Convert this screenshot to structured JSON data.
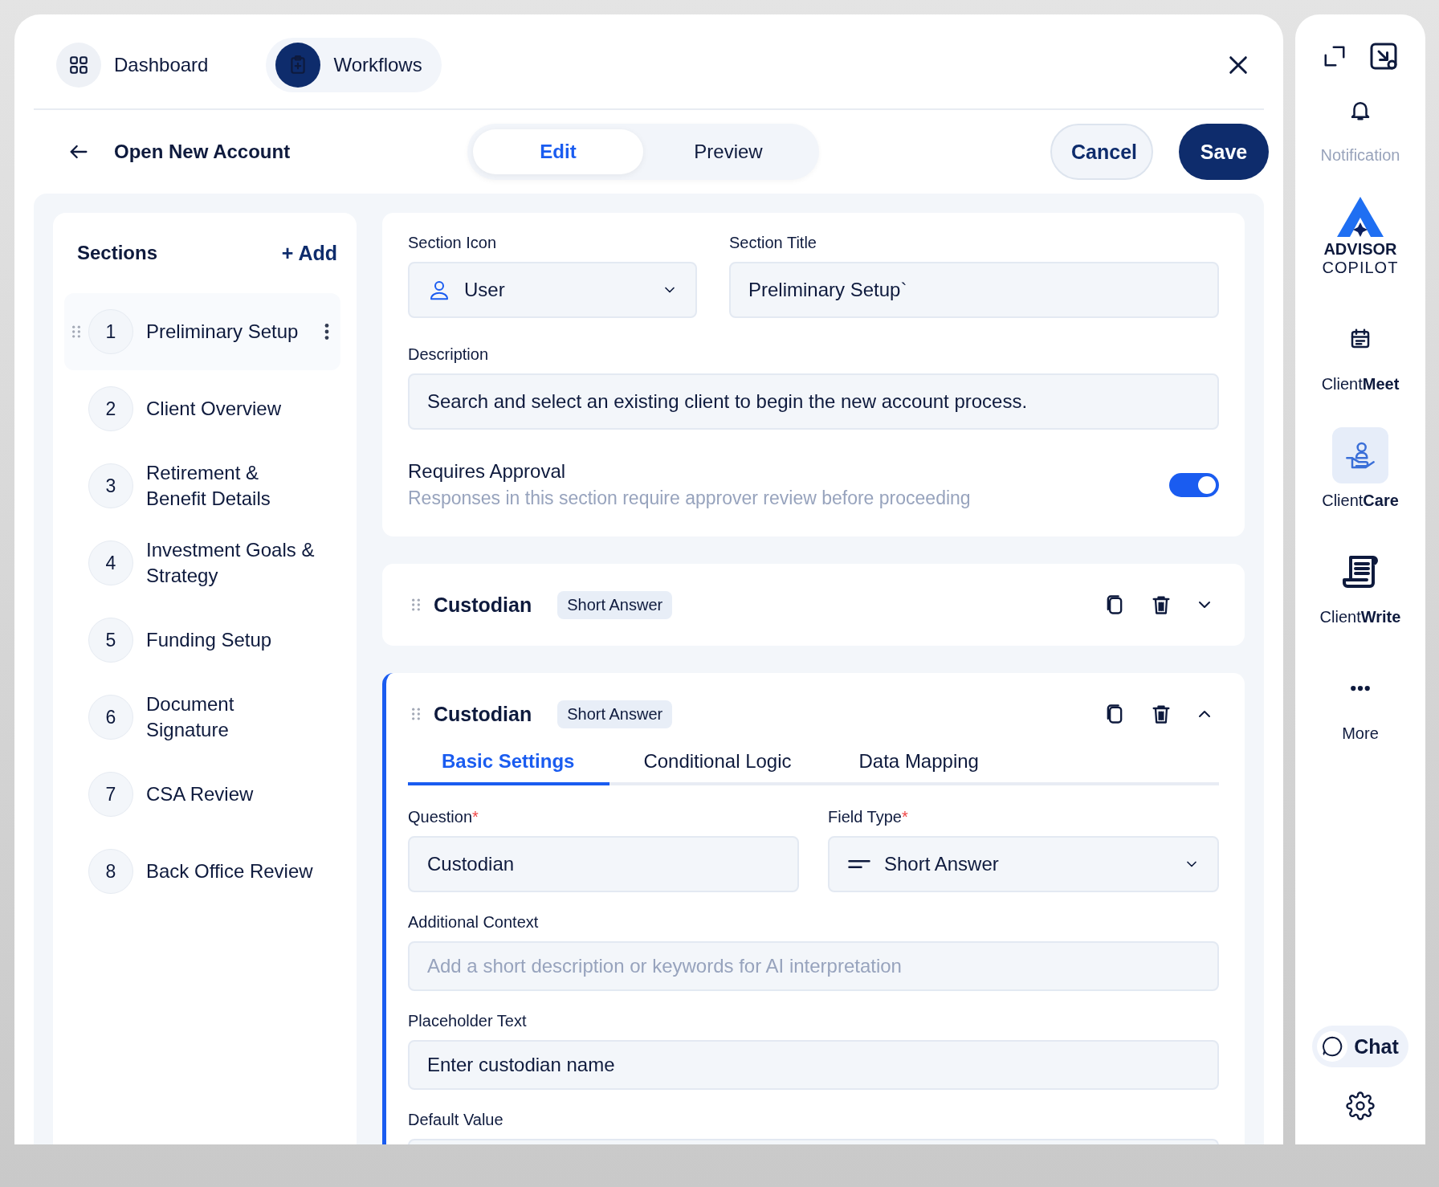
{
  "nav_tabs": [
    {
      "label": "Dashboard",
      "selected": false
    },
    {
      "label": "Workflows",
      "selected": true
    }
  ],
  "header": {
    "title": "Open New Account",
    "mode_tabs": [
      {
        "label": "Edit",
        "selected": true
      },
      {
        "label": "Preview",
        "selected": false
      }
    ],
    "buttons": [
      {
        "label": "Cancel",
        "kind": "secondary"
      },
      {
        "label": "Save",
        "kind": "primary"
      }
    ]
  },
  "sections": {
    "title": "Sections",
    "add_label": "+ Add",
    "items": [
      {
        "number": "1",
        "title": "Preliminary Setup",
        "selected": true
      },
      {
        "number": "2",
        "title": "Client Overview",
        "selected": false
      },
      {
        "number": "3",
        "title": "Retirement & Benefit Details",
        "selected": false
      },
      {
        "number": "4",
        "title": "Investment Goals & Strategy",
        "selected": false
      },
      {
        "number": "5",
        "title": "Funding Setup",
        "selected": false
      },
      {
        "number": "6",
        "title": "Document Signature",
        "selected": false
      },
      {
        "number": "7",
        "title": "CSA Review",
        "selected": false
      },
      {
        "number": "8",
        "title": "Back Office Review",
        "selected": false
      }
    ]
  },
  "section_settings": {
    "icon_label": "Section Icon",
    "icon_value": "User",
    "title_label": "Section Title",
    "title_value": "Preliminary Setup`",
    "description_label": "Description",
    "description_value": "Search and select an existing client to begin the new account process.",
    "approval": {
      "title": "Requires Approval",
      "hint": "Responses in this section require approver review before proceeding",
      "on": true
    }
  },
  "questions": [
    {
      "title": "Custodian",
      "type_badge": "Short Answer",
      "expanded": false
    },
    {
      "title": "Custodian",
      "type_badge": "Short Answer",
      "expanded": true,
      "tabs": [
        {
          "label": "Basic Settings",
          "selected": true
        },
        {
          "label": "Conditional Logic",
          "selected": false
        },
        {
          "label": "Data Mapping",
          "selected": false
        }
      ],
      "field_rows": [
        [
          {
            "label": "Question",
            "required_mark": "*",
            "kind": "text",
            "value": "Custodian"
          },
          {
            "label": "Field Type",
            "required_mark": "*",
            "kind": "select",
            "value": "Short Answer"
          }
        ],
        [
          {
            "label": "Additional Context",
            "kind": "text",
            "placeholder": "Add a short description or keywords for AI interpretation"
          }
        ],
        [
          {
            "label": "Placeholder Text",
            "kind": "text",
            "value": "Enter custodian name"
          }
        ],
        [
          {
            "label": "Default Value",
            "kind": "text"
          }
        ]
      ]
    }
  ],
  "side_rail": {
    "items": [
      {
        "kind": "notification",
        "label": "Notification",
        "disabled": true,
        "selected": false
      },
      {
        "kind": "logo",
        "label": "ADVISOR",
        "sublabel": "COPILOT"
      },
      {
        "kind": "meet",
        "label": "Client**Meet**",
        "disabled": false,
        "selected": false
      },
      {
        "kind": "care",
        "label": "Client**Care**",
        "disabled": false,
        "selected": true
      },
      {
        "kind": "write",
        "label": "Client**Write**",
        "disabled": false,
        "selected": false
      },
      {
        "kind": "more",
        "label": "More",
        "disabled": false,
        "selected": false
      }
    ],
    "chat": {
      "label": "Chat"
    }
  }
}
